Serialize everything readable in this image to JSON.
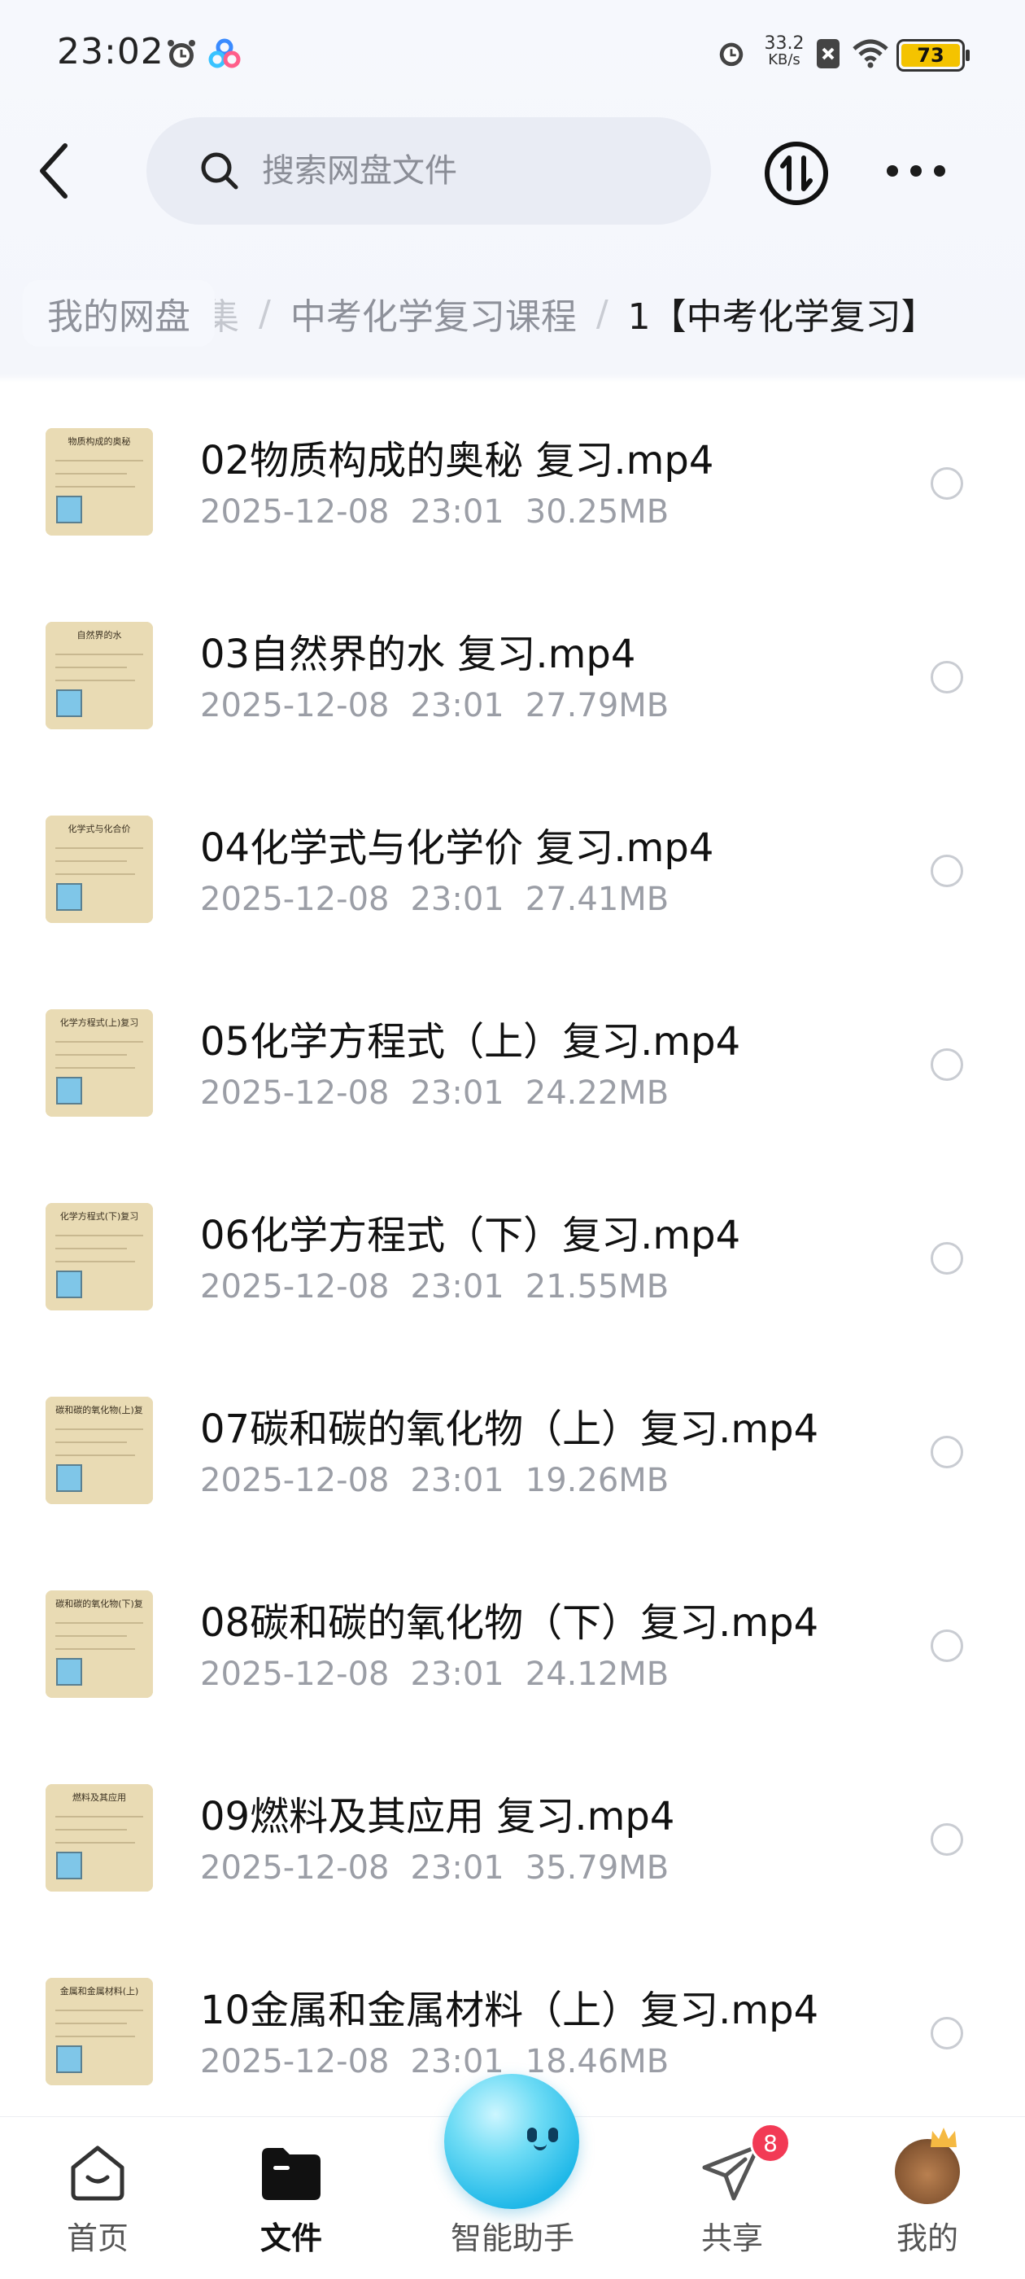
{
  "status_bar": {
    "time": "23:02",
    "net_speed_value": "33.2",
    "net_speed_unit": "KB/s",
    "battery": "73"
  },
  "header": {
    "search_placeholder": "搜索网盘文件"
  },
  "breadcrumb": {
    "root": "我的网盘",
    "partial": "集",
    "separator": "/",
    "middle": "中考化学复习课程",
    "current": "1【中考化学复习】"
  },
  "files": [
    {
      "name": "02物质构成的奥秘 复习.mp4",
      "date": "2025-12-08",
      "time": "23:01",
      "size": "30.25MB",
      "thumb_title": "物质构成的奥秘"
    },
    {
      "name": "03自然界的水 复习.mp4",
      "date": "2025-12-08",
      "time": "23:01",
      "size": "27.79MB",
      "thumb_title": "自然界的水"
    },
    {
      "name": "04化学式与化学价 复习.mp4",
      "date": "2025-12-08",
      "time": "23:01",
      "size": "27.41MB",
      "thumb_title": "化学式与化合价"
    },
    {
      "name": "05化学方程式（上）复习.mp4",
      "date": "2025-12-08",
      "time": "23:01",
      "size": "24.22MB",
      "thumb_title": "化学方程式(上)复习"
    },
    {
      "name": "06化学方程式（下）复习.mp4",
      "date": "2025-12-08",
      "time": "23:01",
      "size": "21.55MB",
      "thumb_title": "化学方程式(下)复习"
    },
    {
      "name": "07碳和碳的氧化物（上）复习.mp4",
      "date": "2025-12-08",
      "time": "23:01",
      "size": "19.26MB",
      "thumb_title": "碳和碳的氧化物(上)复"
    },
    {
      "name": "08碳和碳的氧化物（下）复习.mp4",
      "date": "2025-12-08",
      "time": "23:01",
      "size": "24.12MB",
      "thumb_title": "碳和碳的氧化物(下)复"
    },
    {
      "name": "09燃料及其应用 复习.mp4",
      "date": "2025-12-08",
      "time": "23:01",
      "size": "35.79MB",
      "thumb_title": "燃料及其应用"
    },
    {
      "name": "10金属和金属材料（上）复习.mp4",
      "date": "2025-12-08",
      "time": "23:01",
      "size": "18.46MB",
      "thumb_title": "金属和金属材料(上)"
    }
  ],
  "bottom_nav": {
    "home": "首页",
    "files": "文件",
    "assistant": "智能助手",
    "share": "共享",
    "me": "我的",
    "share_badge": "8"
  },
  "colors": {
    "accent_badge": "#f23a55",
    "battery": "#f4c300",
    "assistant_orb": "#1fb8e8"
  }
}
